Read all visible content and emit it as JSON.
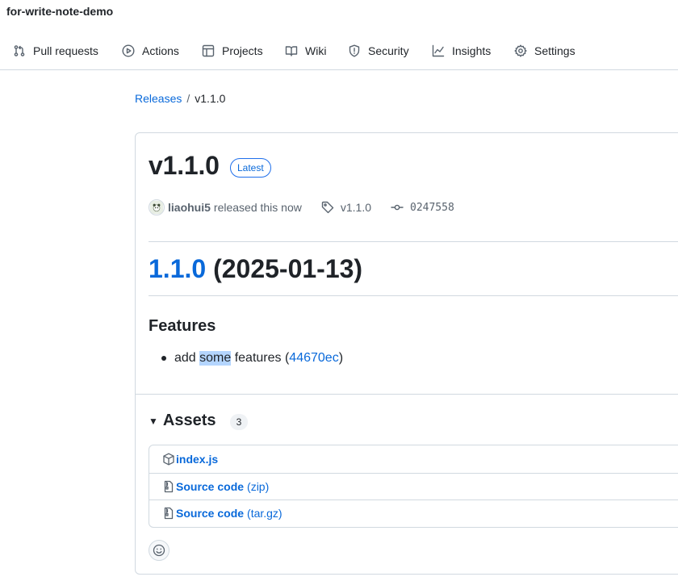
{
  "repo": {
    "name": "for-write-note-demo"
  },
  "nav": {
    "items": [
      {
        "label": "Pull requests",
        "icon": "git-pull-request-icon"
      },
      {
        "label": "Actions",
        "icon": "play-icon"
      },
      {
        "label": "Projects",
        "icon": "table-icon"
      },
      {
        "label": "Wiki",
        "icon": "book-icon"
      },
      {
        "label": "Security",
        "icon": "shield-icon"
      },
      {
        "label": "Insights",
        "icon": "graph-icon"
      },
      {
        "label": "Settings",
        "icon": "gear-icon"
      }
    ]
  },
  "breadcrumb": {
    "releases": "Releases",
    "separator": "/",
    "current": "v1.1.0"
  },
  "release": {
    "title": "v1.1.0",
    "badge": "Latest",
    "author": "liaohui5",
    "released_text": "released this now",
    "tag": "v1.1.0",
    "commit": "0247558"
  },
  "notes": {
    "version_link": "1.1.0",
    "date": "(2025-01-13)",
    "features_heading": "Features",
    "feature": {
      "prefix": "add ",
      "highlighted": "some",
      "middle": " features (",
      "commit_link": "44670ec",
      "suffix": ")"
    }
  },
  "assets": {
    "heading": "Assets",
    "count": "3",
    "items": [
      {
        "name": "index.js",
        "suffix": "",
        "icon": "package-icon"
      },
      {
        "name": "Source code",
        "suffix": "(zip)",
        "icon": "file-zip-icon"
      },
      {
        "name": "Source code",
        "suffix": "(tar.gz)",
        "icon": "file-zip-icon"
      }
    ]
  },
  "colors": {
    "link": "#0969da",
    "border": "#d1d9e0",
    "text": "#1f2328",
    "muted": "#59636e",
    "highlight": "#b4d5fe"
  }
}
